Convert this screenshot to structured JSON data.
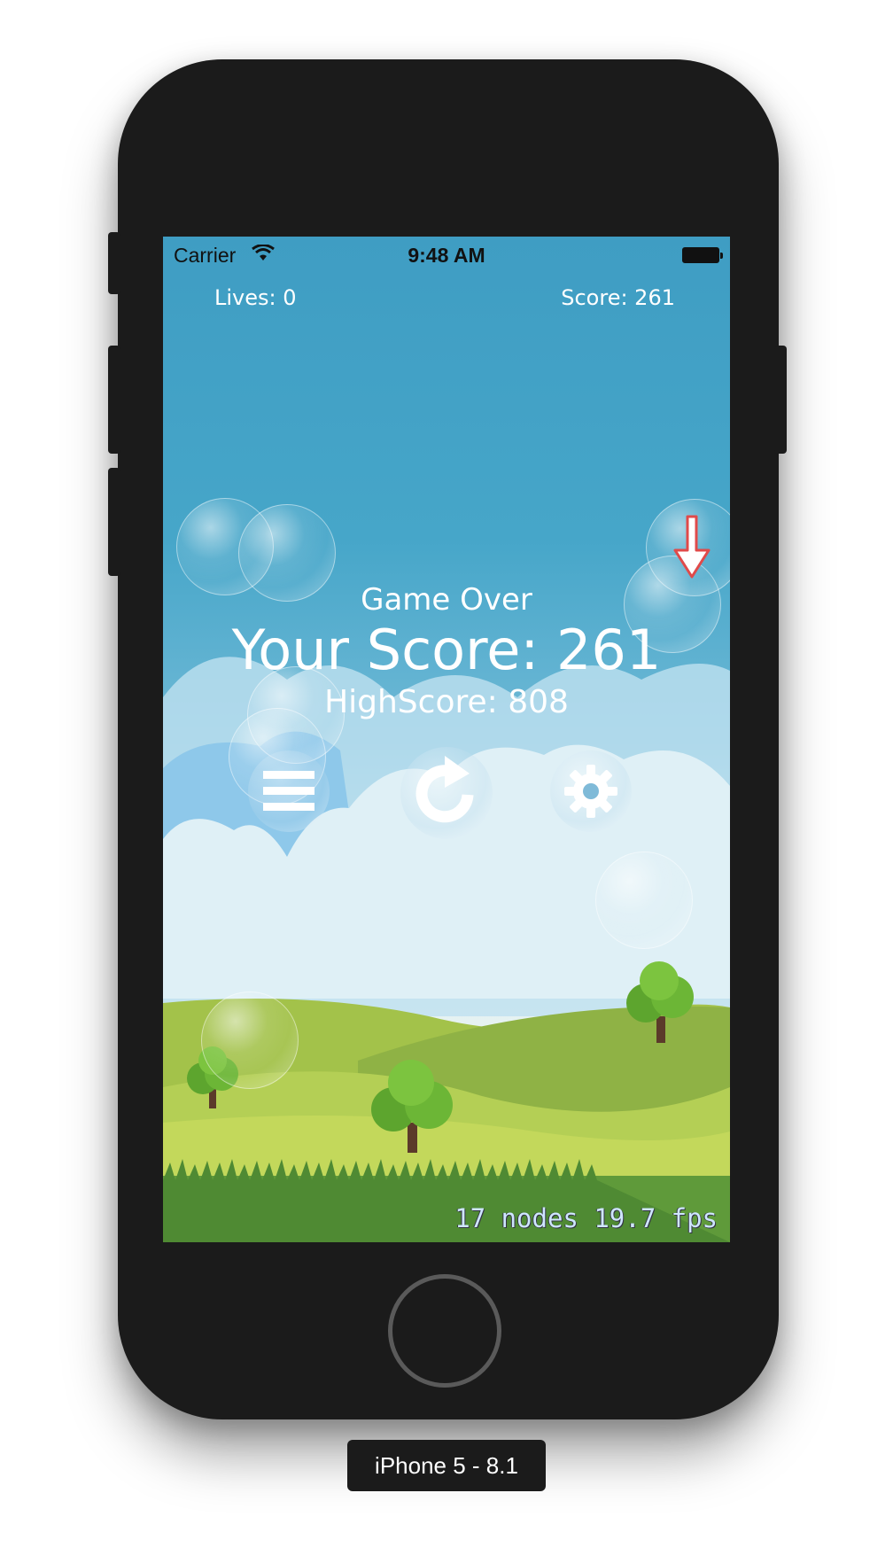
{
  "status_bar": {
    "carrier": "Carrier",
    "time": "9:48 AM"
  },
  "hud": {
    "lives": "Lives: 0",
    "score": "Score: 261"
  },
  "game_over": {
    "title": "Game Over",
    "your_score": "Your Score: 261",
    "high_score": "HighScore: 808"
  },
  "buttons": {
    "menu_icon": "menu-icon",
    "restart_icon": "restart-icon",
    "settings_icon": "gear-icon"
  },
  "debug": {
    "stats": "17 nodes 19.7 fps"
  },
  "simulator": {
    "device_label": "iPhone 5 - 8.1"
  },
  "colors": {
    "sky_top": "#3f9dc3",
    "hill_green": "#a8c94c",
    "device_body": "#1b1b1b",
    "arrow_red": "#e04a4a"
  }
}
